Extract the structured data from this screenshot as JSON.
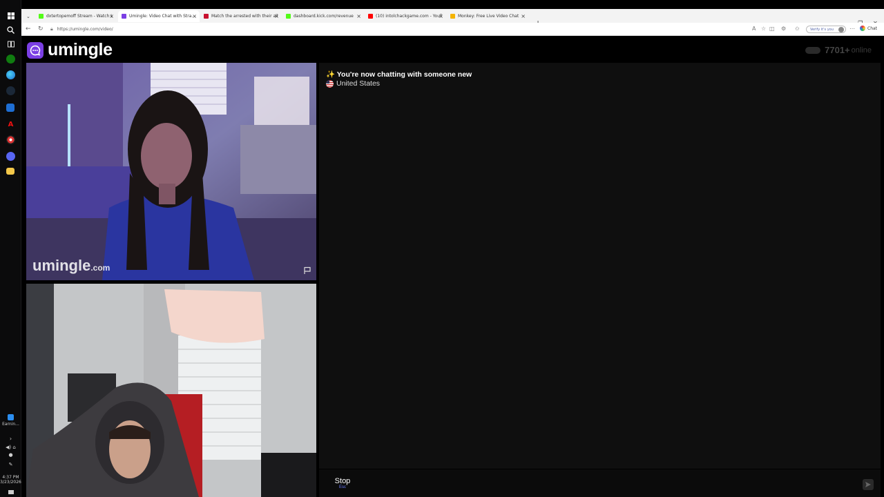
{
  "taskbar": {
    "clock_time": "4:37 PM",
    "clock_date": "3/23/2026",
    "earnings_label": "Earnin...",
    "icons": [
      "windows-start-icon",
      "search-icon",
      "task-view-icon",
      "xbox-icon",
      "edge-icon",
      "steam-icon",
      "calendar-icon",
      "adobe-icon",
      "obs-icon",
      "discord-icon",
      "file-explorer-icon"
    ]
  },
  "browser": {
    "tabs": [
      {
        "title": "dxtertopemoff Stream - Watch Li...",
        "favicon_color": "#53fc18",
        "active": false
      },
      {
        "title": "Umingle: Video Chat with Stra...",
        "favicon_color": "#7b3fe4",
        "active": true
      },
      {
        "title": "Match the arrested with their alleg...",
        "favicon_color": "#c8102e",
        "active": false
      },
      {
        "title": "dashboard.kick.com/revenue",
        "favicon_color": "#53fc18",
        "active": false
      },
      {
        "title": "(10) intolchackgame.com - YouTu...",
        "favicon_color": "#ff0000",
        "active": false
      },
      {
        "title": "Monkey: Free Live Video Chat",
        "favicon_color": "#f5b400",
        "active": false
      }
    ],
    "url": "https://umingle.com/video/",
    "verify_label": "Verify it's you",
    "chat_label": "Chat"
  },
  "site": {
    "logo_text": "umingle",
    "online_count": "7701+",
    "online_label": "online",
    "watermark_main": "umingle",
    "watermark_suffix": ".com"
  },
  "chat": {
    "system_message": "✨ You're now chatting with someone new",
    "country": "United States"
  },
  "controls": {
    "stop_label": "Stop",
    "stop_shortcut": "Esc"
  },
  "colors": {
    "brand": "#7b3fe4",
    "accent": "#6b7dff"
  }
}
